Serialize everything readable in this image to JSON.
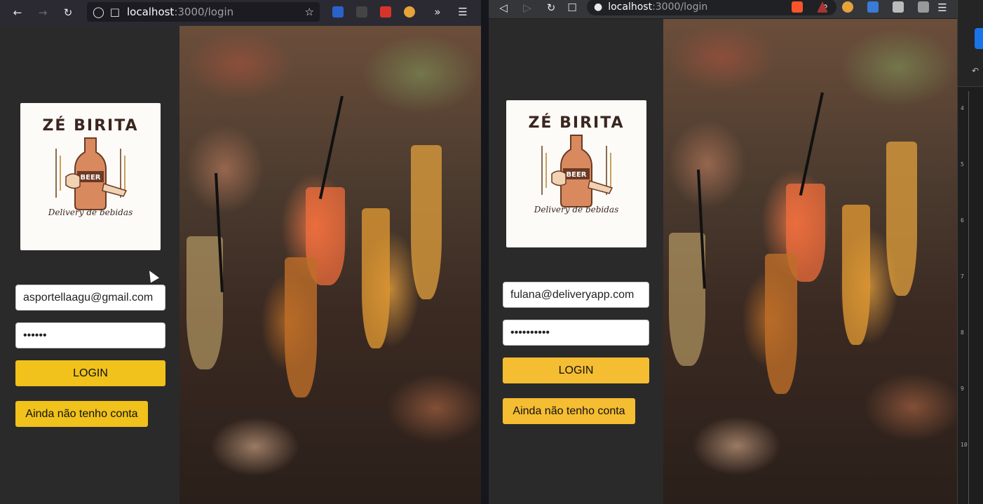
{
  "windows": {
    "left": {
      "url_host": "localhost",
      "url_rest": ":3000/login",
      "form": {
        "email_value": "asportellaagu@gmail.com",
        "password_value": "••••••",
        "login_label": "LOGIN",
        "register_label": "Ainda não tenho conta"
      }
    },
    "right": {
      "url_host": "localhost",
      "url_rest": ":3000/login",
      "form": {
        "email_value": "fulana@deliveryapp.com",
        "password_value": "••••••••••",
        "login_label": "LOGIN",
        "register_label": "Ainda não tenho conta"
      }
    }
  },
  "logo": {
    "title": "ZÉ BIRITA",
    "label": "BEER",
    "subtitle": "Delivery de bebidas"
  },
  "devtools": {
    "ruler_ticks": [
      "4",
      "5",
      "6",
      "7",
      "8",
      "9",
      "10"
    ]
  },
  "colors": {
    "button_left": "#f0c21b",
    "button_right": "#f5bd32",
    "sidebar_bg": "#2b2a2a"
  }
}
